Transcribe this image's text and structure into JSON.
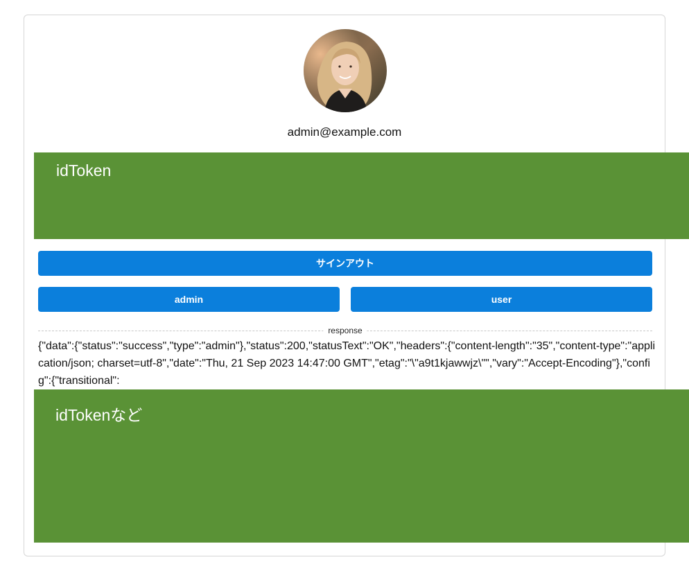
{
  "user": {
    "email": "admin@example.com"
  },
  "overlays": {
    "top_label": "idToken",
    "bottom_label": "idTokenなど"
  },
  "buttons": {
    "signout": "サインアウト",
    "admin": "admin",
    "user": "user"
  },
  "response": {
    "divider_label": "response",
    "text": "{\"data\":{\"status\":\"success\",\"type\":\"admin\"},\"status\":200,\"statusText\":\"OK\",\"headers\":{\"content-length\":\"35\",\"content-type\":\"application/json; charset=utf-8\",\"date\":\"Thu, 21 Sep 2023 14:47:00 GMT\",\"etag\":\"\\\"a9t1kjawwjz\\\"\",\"vary\":\"Accept-Encoding\"},\"config\":{\"transitional\":"
  },
  "colors": {
    "overlay_green": "#5a9236",
    "button_blue": "#0b7fdc"
  }
}
